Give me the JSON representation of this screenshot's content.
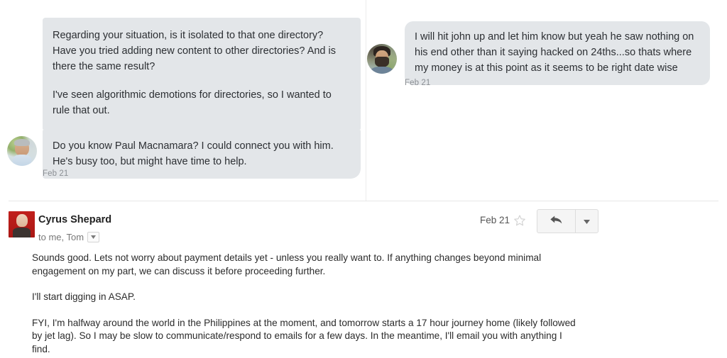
{
  "chat": {
    "messages": [
      {
        "side": "left",
        "paragraphs": [
          "Regarding your situation, is it isolated to that one directory? Have you tried adding new content to other directories? And is there the same result?",
          "I've seen algorithmic demotions for directories, so I wanted to rule that out."
        ]
      },
      {
        "side": "left",
        "paragraphs": [
          "Do you know Paul Macnamara? I could connect you with him. He's busy too, but might have time to help."
        ],
        "timestamp": "Feb 21"
      },
      {
        "side": "right",
        "paragraphs": [
          "I will hit john up and let him know but yeah he saw nothing on his end other than it saying hacked on 24ths...so thats where my money is at this point as it seems to be right date wise"
        ],
        "timestamp": "Feb 21"
      }
    ],
    "left_timestamp": "Feb 21",
    "right_timestamp": "Feb 21",
    "bubble_color": "#e3e6e9",
    "timestamp_color": "#8b8f94"
  },
  "email": {
    "sender": "Cyrus Shepard",
    "recipients": "to me, Tom",
    "date": "Feb 21",
    "icons": {
      "recipients_caret": "chevron-down-icon",
      "star": "star-outline-icon",
      "reply": "reply-arrow-icon",
      "more": "chevron-down-icon"
    },
    "body": [
      "Sounds good. Lets not worry about payment details yet - unless you really want to. If anything changes beyond minimal engagement on my part, we can discuss it before proceeding further.",
      "I'll start digging in ASAP.",
      "FYI, I'm halfway around the world in the Philippines at the moment, and tomorrow starts a 17 hour journey home (likely followed by jet lag). So I may be slow to communicate/respond to emails for a few days. In the meantime, I'll email you with anything I find."
    ],
    "avatar_color": "#b71c1c",
    "text_color": "#2b2b2b"
  }
}
